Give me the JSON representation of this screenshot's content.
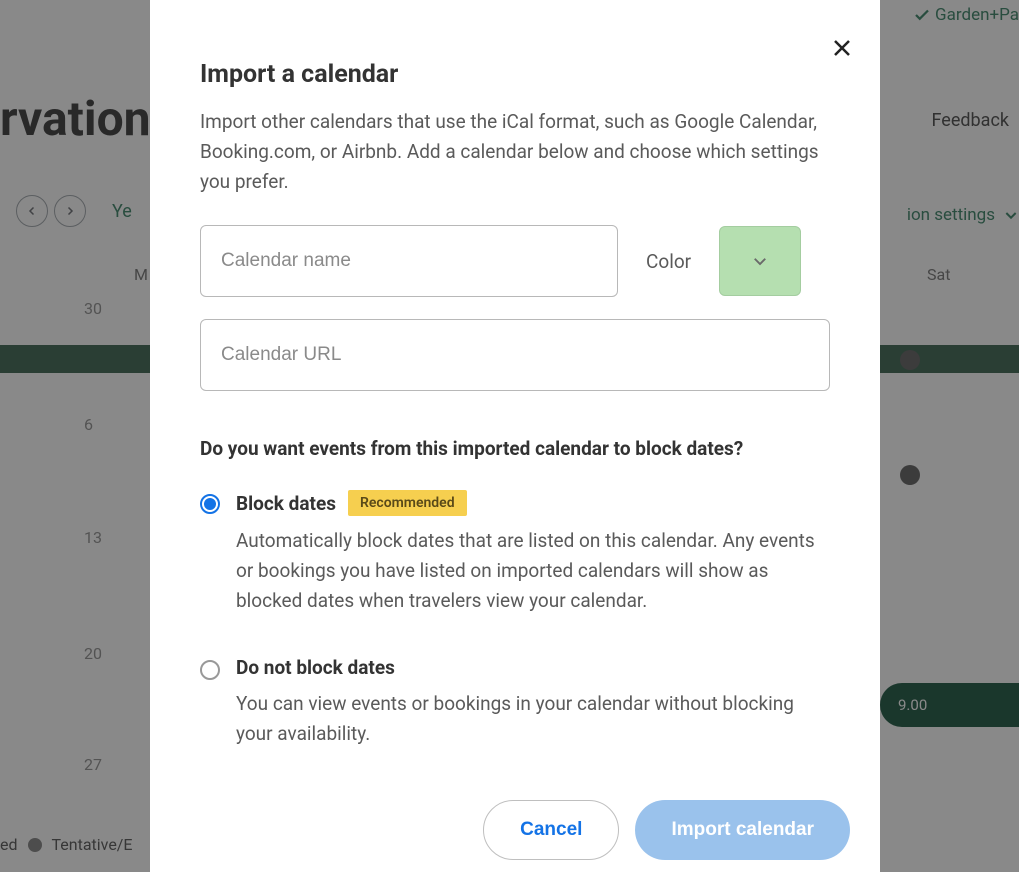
{
  "background": {
    "topbar_link": "Garden+Pa",
    "header": "rvations",
    "feedback": "Feedback",
    "nav_num": "",
    "year": "Ye",
    "settings": "ion settings",
    "day_mon": "M",
    "day_sat": "Sat",
    "dates": [
      "30",
      "6",
      "13",
      "20",
      "27"
    ],
    "booking_amount": "9.00",
    "legend_ed": "ed",
    "legend_tentative": "Tentative/E"
  },
  "modal": {
    "title": "Import a calendar",
    "description": "Import other calendars that use the iCal format, such as Google Calendar, Booking.com, or Airbnb. Add a calendar below and choose which settings you prefer.",
    "name_placeholder": "Calendar name",
    "color_label": "Color",
    "url_placeholder": "Calendar URL",
    "question": "Do you want events from this imported calendar to block dates?",
    "options": [
      {
        "title": "Block dates",
        "badge": "Recommended",
        "selected": true,
        "desc": "Automatically block dates that are listed on this calendar. Any events or bookings you have listed on imported calendars will show as blocked dates when travelers view your calendar."
      },
      {
        "title": "Do not block dates",
        "badge": null,
        "selected": false,
        "desc": "You can view events or bookings in your calendar without blocking your availability."
      }
    ],
    "cancel": "Cancel",
    "import": "Import calendar"
  }
}
